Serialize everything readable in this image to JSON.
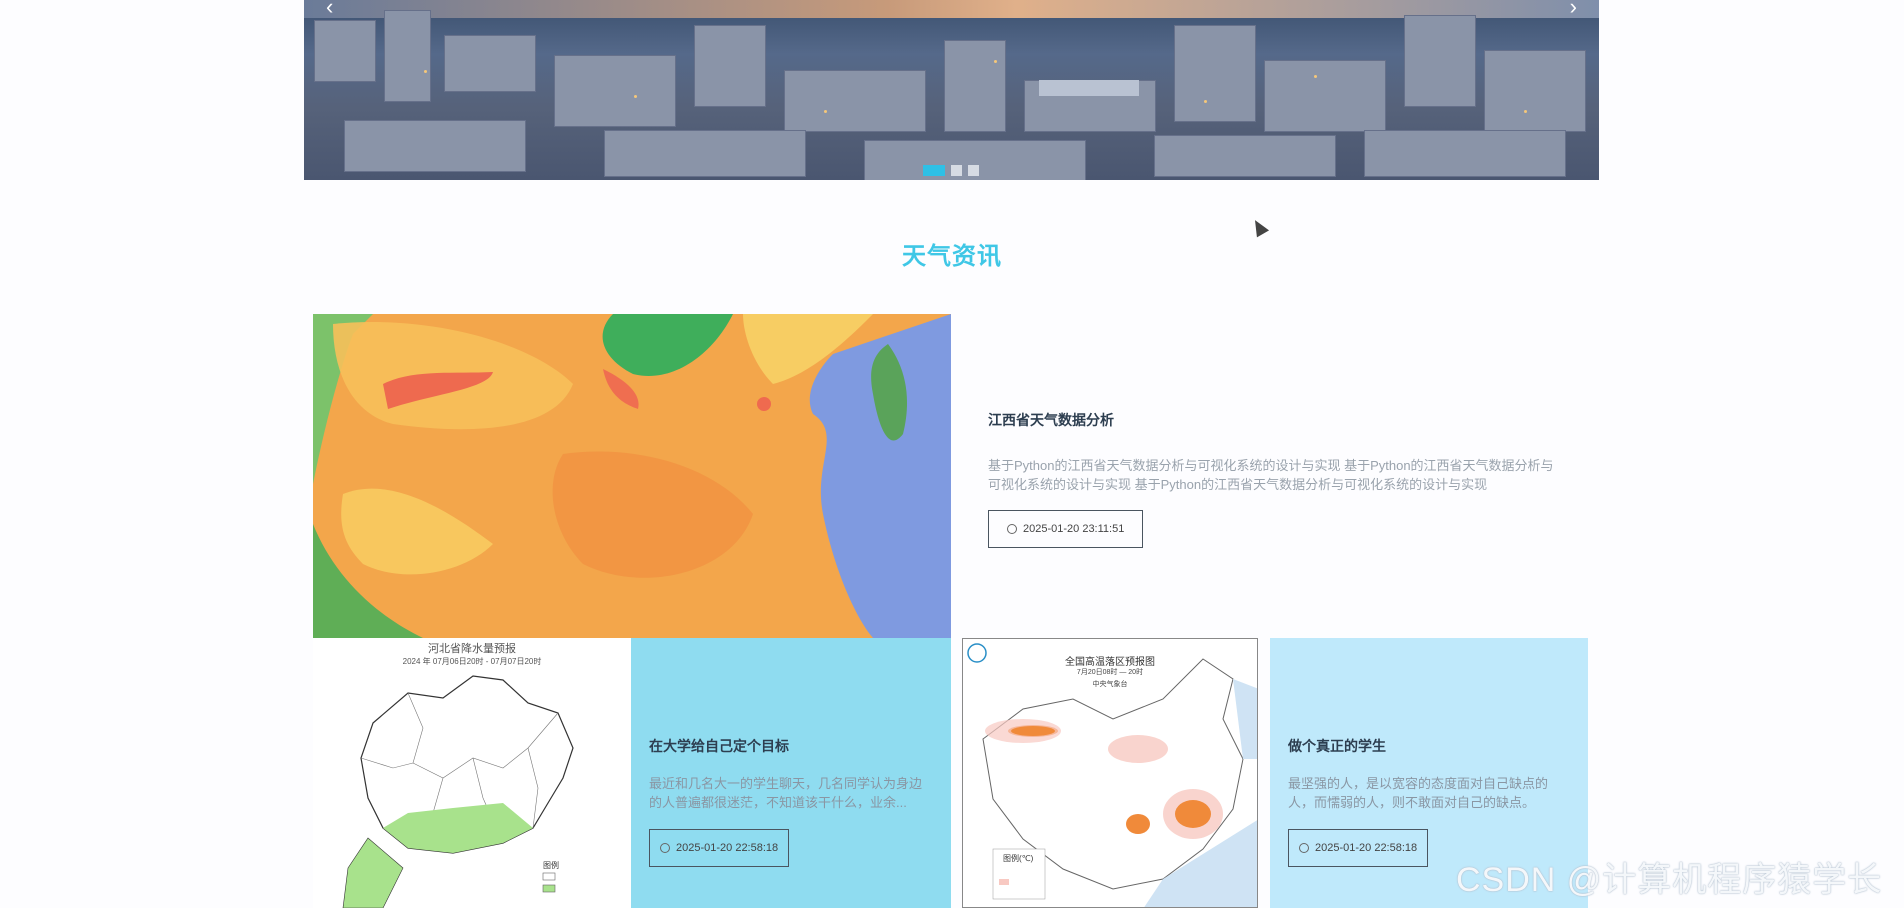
{
  "banner": {
    "prev_icon": "chevron-left-icon",
    "next_icon": "chevron-right-icon",
    "active_slide": 1,
    "slide_count": 3
  },
  "section": {
    "title": "天气资讯"
  },
  "featured": {
    "title": "江西省天气数据分析",
    "description": "基于Python的江西省天气数据分析与可视化系统的设计与实现 基于Python的江西省天气数据分析与可视化系统的设计与实现 基于Python的江西省天气数据分析与可视化系统的设计与实现",
    "date": "2025-01-20 23:11:51"
  },
  "cards": [
    {
      "image_title": "河北省降水量预报",
      "image_subtitle": "2024 年 07月06日20时 - 07月07日20时",
      "legend_label": "图例",
      "title": "在大学给自己定个目标",
      "description": "最近和几名大一的学生聊天，几名同学认为身边的人普遍都很迷茫，不知道该干什么，业余...",
      "date": "2025-01-20 22:58:18",
      "bg": "#8fdcf0"
    },
    {
      "image_title": "全国高温落区预报图",
      "image_subtitle": "7月20日08时 — 20时",
      "image_source": "中央气象台",
      "legend_label": "图例(℃)",
      "title": "做个真正的学生",
      "description": "最坚强的人，是以宽容的态度面对自己缺点的人，而懦弱的人，则不敢面对自己的缺点。",
      "date": "2025-01-20 22:58:18",
      "bg": "#bfe9fb"
    }
  ],
  "watermark": "CSDN @计算机程序猿学长"
}
